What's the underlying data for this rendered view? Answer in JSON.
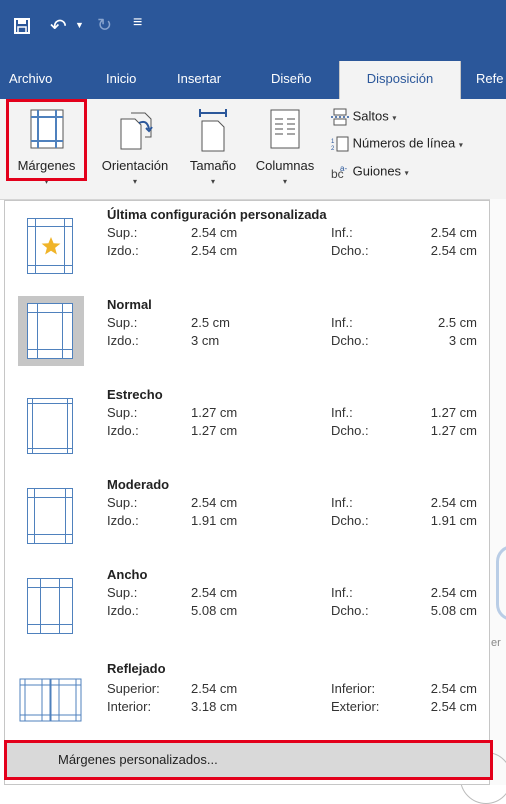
{
  "qat": {
    "save_icon": "save-icon",
    "undo_icon": "undo-icon",
    "redo_icon": "redo-icon",
    "customize_icon": "qat-dropdown-icon"
  },
  "tabs": [
    {
      "label": "Archivo"
    },
    {
      "label": "Inicio"
    },
    {
      "label": "Insertar"
    },
    {
      "label": "Diseño"
    },
    {
      "label": "Disposición"
    },
    {
      "label": "Refe"
    }
  ],
  "ribbon": {
    "margins": "Márgenes",
    "orientation": "Orientación",
    "size": "Tamaño",
    "columns": "Columnas",
    "breaks": "Saltos",
    "line_numbers": "Números de línea",
    "hyphenation": "Guiones",
    "caret": "▾"
  },
  "margin_options": [
    {
      "title": "Última configuración personalizada",
      "top_label": "Sup.:",
      "top": "2.54 cm",
      "bottom_label": "Inf.:",
      "bottom": "2.54 cm",
      "left_label": "Izdo.:",
      "left": "2.54 cm",
      "right_label": "Dcho.:",
      "right": "2.54 cm"
    },
    {
      "title": "Normal",
      "top_label": "Sup.:",
      "top": "2.5 cm",
      "bottom_label": "Inf.:",
      "bottom": "2.5 cm",
      "left_label": "Izdo.:",
      "left": "3 cm",
      "right_label": "Dcho.:",
      "right": "3 cm"
    },
    {
      "title": "Estrecho",
      "top_label": "Sup.:",
      "top": "1.27 cm",
      "bottom_label": "Inf.:",
      "bottom": "1.27 cm",
      "left_label": "Izdo.:",
      "left": "1.27 cm",
      "right_label": "Dcho.:",
      "right": "1.27 cm"
    },
    {
      "title": "Moderado",
      "top_label": "Sup.:",
      "top": "2.54 cm",
      "bottom_label": "Inf.:",
      "bottom": "2.54 cm",
      "left_label": "Izdo.:",
      "left": "1.91 cm",
      "right_label": "Dcho.:",
      "right": "1.91 cm"
    },
    {
      "title": "Ancho",
      "top_label": "Sup.:",
      "top": "2.54 cm",
      "bottom_label": "Inf.:",
      "bottom": "2.54 cm",
      "left_label": "Izdo.:",
      "left": "5.08 cm",
      "right_label": "Dcho.:",
      "right": "5.08 cm"
    },
    {
      "title": "Reflejado",
      "top_label": "Superior:",
      "top": "2.54 cm",
      "bottom_label": "Inferior:",
      "bottom": "2.54 cm",
      "left_label": "Interior:",
      "left": "3.18 cm",
      "right_label": "Exterior:",
      "right": "2.54 cm"
    }
  ],
  "custom_margins": "Márgenes personalizados...",
  "doc_fragment": "er",
  "colors": {
    "accent": "#2b579a",
    "highlight": "#e3001b",
    "margin_line": "#4f81bd",
    "star": "#f0b429"
  }
}
